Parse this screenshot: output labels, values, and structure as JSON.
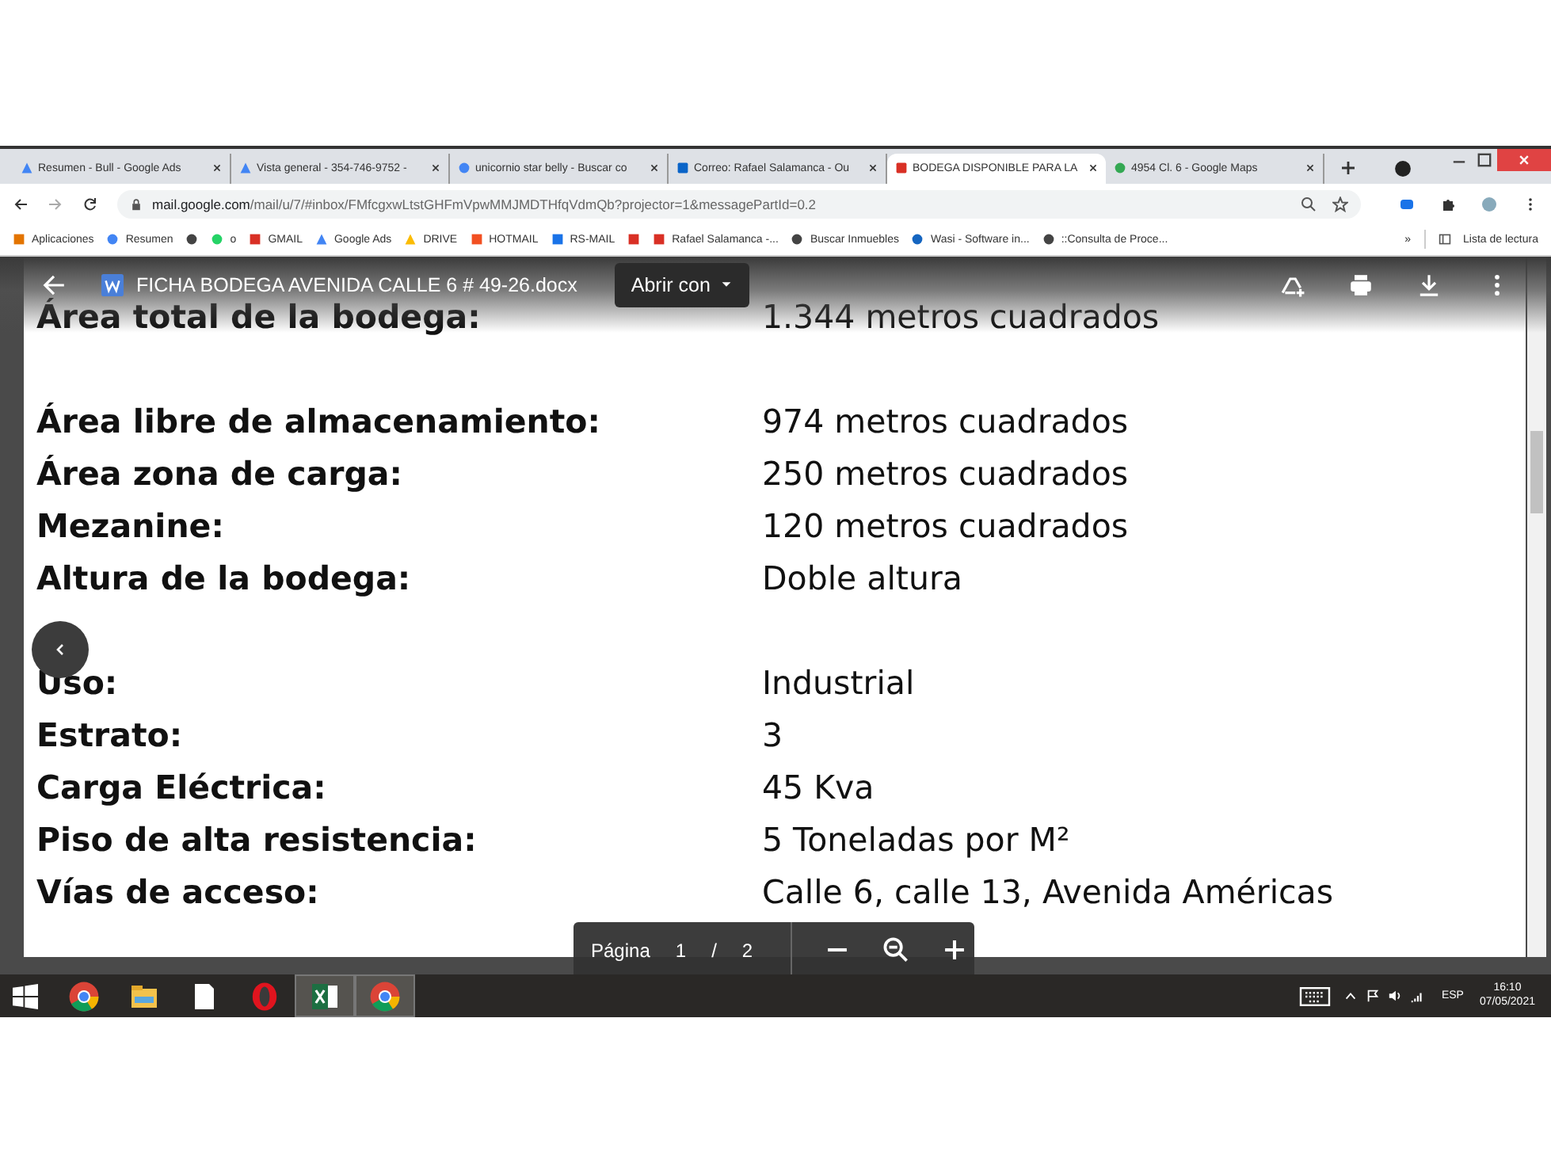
{
  "browser": {
    "tabs": [
      {
        "title": "Resumen - Bull - Google Ads",
        "selected": false
      },
      {
        "title": "Vista general - 354-746-9752 -",
        "selected": false
      },
      {
        "title": "unicornio star belly - Buscar co",
        "selected": false
      },
      {
        "title": "Correo: Rafael Salamanca - Ou",
        "selected": false
      },
      {
        "title": "BODEGA DISPONIBLE PARA LA",
        "selected": true
      },
      {
        "title": "4954 Cl. 6 - Google Maps",
        "selected": false
      }
    ],
    "url_host": "mail.google.com",
    "url_path": "/mail/u/7/#inbox/FMfcgxwLtstGHFmVpwMMJMDTHfqVdmQb?projector=1&messagePartId=0.2",
    "bookmarks": [
      {
        "kind": "link",
        "label": "Aplicaciones"
      },
      {
        "kind": "link",
        "label": "Resumen"
      },
      {
        "kind": "icon"
      },
      {
        "kind": "link",
        "label": "o"
      },
      {
        "kind": "link",
        "label": "GMAIL"
      },
      {
        "kind": "link",
        "label": "Google Ads"
      },
      {
        "kind": "link",
        "label": "DRIVE"
      },
      {
        "kind": "link",
        "label": "HOTMAIL"
      },
      {
        "kind": "link",
        "label": "RS-MAIL"
      },
      {
        "kind": "icon"
      },
      {
        "kind": "link",
        "label": "Rafael Salamanca -..."
      },
      {
        "kind": "link",
        "label": "Buscar Inmuebles"
      },
      {
        "kind": "link",
        "label": "Wasi - Software in..."
      },
      {
        "kind": "link",
        "label": "::Consulta de Proce..."
      }
    ],
    "more_bookmarks": "»",
    "reading_list": "Lista de lectura"
  },
  "viewer": {
    "file_name": "FICHA BODEGA AVENIDA CALLE 6 # 49-26.docx",
    "open_with": "Abrir con",
    "sections": [
      [
        {
          "label": "Área total de la bodega:",
          "value": "1.344 metros cuadrados"
        }
      ],
      [
        {
          "label": "Área libre de almacenamiento:",
          "value": "974 metros cuadrados"
        },
        {
          "label": "Área zona de carga:",
          "value": "250 metros cuadrados"
        },
        {
          "label": "Mezanine:",
          "value": "120 metros cuadrados"
        },
        {
          "label": "Altura de la bodega:",
          "value": "Doble altura"
        }
      ],
      [
        {
          "label": "Uso:",
          "value": "Industrial"
        },
        {
          "label": "Estrato:",
          "value": "3"
        },
        {
          "label": "Carga Eléctrica:",
          "value": "45 Kva"
        },
        {
          "label": "Piso de alta resistencia:",
          "value": "5 Toneladas por M²"
        },
        {
          "label": "Vías de acceso:",
          "value": "Calle 6, calle 13, Avenida Américas"
        }
      ]
    ],
    "page_label": "Página",
    "page_current": "1",
    "page_separator": "/",
    "page_total": "2"
  },
  "taskbar": {
    "apps": [
      {
        "active": false
      },
      {
        "active": false
      },
      {
        "active": false
      },
      {
        "active": false
      },
      {
        "active": true
      },
      {
        "active": true
      }
    ],
    "language": "ESP",
    "time": "16:10",
    "date": "07/05/2021"
  }
}
